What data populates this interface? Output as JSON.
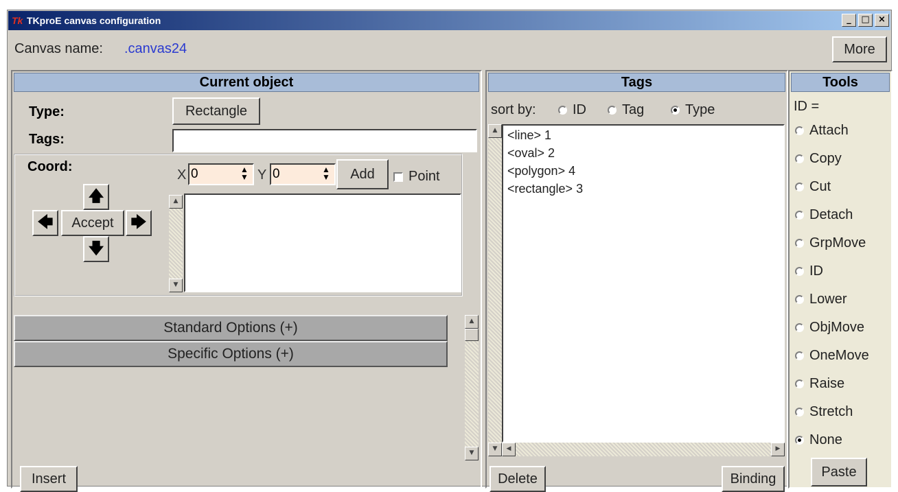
{
  "window": {
    "title": "TKproE canvas configuration",
    "icon": "Tk"
  },
  "titlebar_buttons": {
    "minimize": "_",
    "maximize": "□",
    "close": "×"
  },
  "canvas": {
    "label": "Canvas name:",
    "value": ".canvas24",
    "more_button": "More"
  },
  "current_object": {
    "header": "Current object",
    "type_label": "Type:",
    "type_value": "Rectangle",
    "tags_label": "Tags:",
    "tags_value": "",
    "coord_label": "Coord:",
    "x_label": "X",
    "x_value": "0",
    "y_label": "Y",
    "y_value": "0",
    "add_button": "Add",
    "point_label": "Point",
    "accept_button": "Accept",
    "standard_options": "Standard Options (+)",
    "specific_options": "Specific Options (+)",
    "insert_button": "Insert"
  },
  "tags_panel": {
    "header": "Tags",
    "sort_label": "sort by:",
    "sort_options": [
      "ID",
      "Tag",
      "Type"
    ],
    "sort_selected": "Type",
    "items": [
      "<line> 1",
      "<oval> 2",
      "<polygon> 4",
      "<rectangle> 3"
    ],
    "delete_button": "Delete",
    "binding_button": "Binding"
  },
  "tools_panel": {
    "header": "Tools",
    "id_label": "ID =",
    "options": [
      "Attach",
      "Copy",
      "Cut",
      "Detach",
      "GrpMove",
      "ID",
      "Lower",
      "ObjMove",
      "OneMove",
      "Raise",
      "Stretch",
      "None"
    ],
    "selected": "None",
    "paste_button": "Paste"
  }
}
